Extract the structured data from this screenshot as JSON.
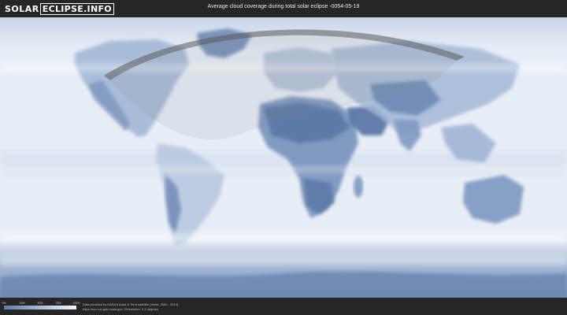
{
  "header": {
    "logo_solar": "SOLAR",
    "logo_eclipse": "ECLIPSE.INFO",
    "title": "Average cloud coverage during total solar eclipse -0054-05-19"
  },
  "legend": {
    "ticks": [
      "0%",
      "25%",
      "50%",
      "75%",
      "100%"
    ],
    "gradient_colors": [
      "#5d7eac",
      "#8ea7c9",
      "#c3d2e6",
      "#f3f6fb"
    ]
  },
  "footer": {
    "credit_line1": "Data provided by NASA's Aqua & Terra satellite (Years: 2000 - 2019)",
    "credit_line2": "https://neo.sci.gsfc.nasa.gov | Resolution: 0.1 degrees"
  },
  "map": {
    "ocean_color": "#e6edf6",
    "land_cloud_color": "#7f9cc4",
    "dry_region_color": "#5f7ca8",
    "path_color": "#5a5a5a"
  }
}
